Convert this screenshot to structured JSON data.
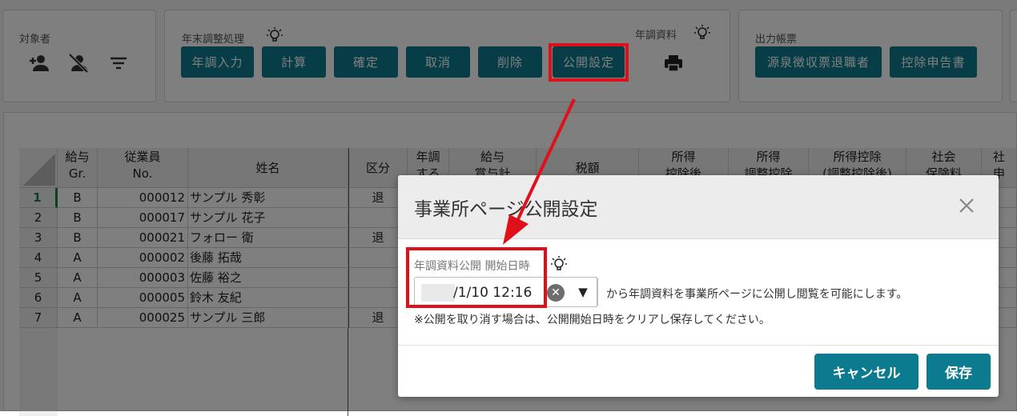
{
  "toolbar": {
    "subject": {
      "label": "対象者"
    },
    "year_end": {
      "label": "年末調整処理",
      "buttons": [
        "年調入力",
        "計算",
        "確定",
        "取消",
        "削除",
        "公開設定"
      ]
    },
    "materials": {
      "label": "年調資料"
    },
    "output": {
      "label": "出力帳票",
      "buttons": [
        "源泉徴収票退職者",
        "控除申告書"
      ]
    }
  },
  "grid": {
    "headers": [
      [
        "給与",
        "Gr."
      ],
      [
        "従業員",
        "No."
      ],
      [
        "姓名"
      ],
      [
        "区分"
      ],
      [
        "年調",
        "する"
      ],
      [
        "給与",
        "賞与計"
      ],
      [
        "税額"
      ],
      [
        "所得",
        "控除後"
      ],
      [
        "所得",
        "調整控除"
      ],
      [
        "所得控除",
        "(調整控除後)"
      ],
      [
        "社会",
        "保険料"
      ],
      [
        "社",
        "申"
      ]
    ],
    "rows": [
      {
        "num": "1",
        "gr": "B",
        "no": "000012",
        "name": "サンプル 秀彰",
        "kubun": "退"
      },
      {
        "num": "2",
        "gr": "B",
        "no": "000017",
        "name": "サンプル 花子",
        "kubun": ""
      },
      {
        "num": "3",
        "gr": "B",
        "no": "000021",
        "name": "フォロー 衛",
        "kubun": "退"
      },
      {
        "num": "4",
        "gr": "A",
        "no": "000002",
        "name": "後藤 拓哉",
        "kubun": ""
      },
      {
        "num": "5",
        "gr": "A",
        "no": "000003",
        "name": "佐藤 裕之",
        "kubun": ""
      },
      {
        "num": "6",
        "gr": "A",
        "no": "000005",
        "name": "鈴木 友紀",
        "kubun": ""
      },
      {
        "num": "7",
        "gr": "A",
        "no": "000025",
        "name": "サンプル 三郎",
        "kubun": "退"
      }
    ]
  },
  "modal": {
    "title": "事業所ページ公開設定",
    "field_label": "年調資料公開 開始日時",
    "datetime_value": "/1/10 12:16",
    "description": "から年調資料を事業所ページに公開し閲覧を可能にします。",
    "note": "※公開を取り消す場合は、公開開始日時をクリアし保存してください。",
    "cancel_label": "キャンセル",
    "save_label": "保存",
    "dropdown_glyph": "▼",
    "clear_glyph": "✕"
  },
  "colors": {
    "accent": "#0d7b8f",
    "highlight": "#e0101a"
  },
  "icons": [
    "add-person-icon",
    "remove-person-icon",
    "filter-sort-icon",
    "lightbulb-icon",
    "printer-icon",
    "close-icon"
  ]
}
